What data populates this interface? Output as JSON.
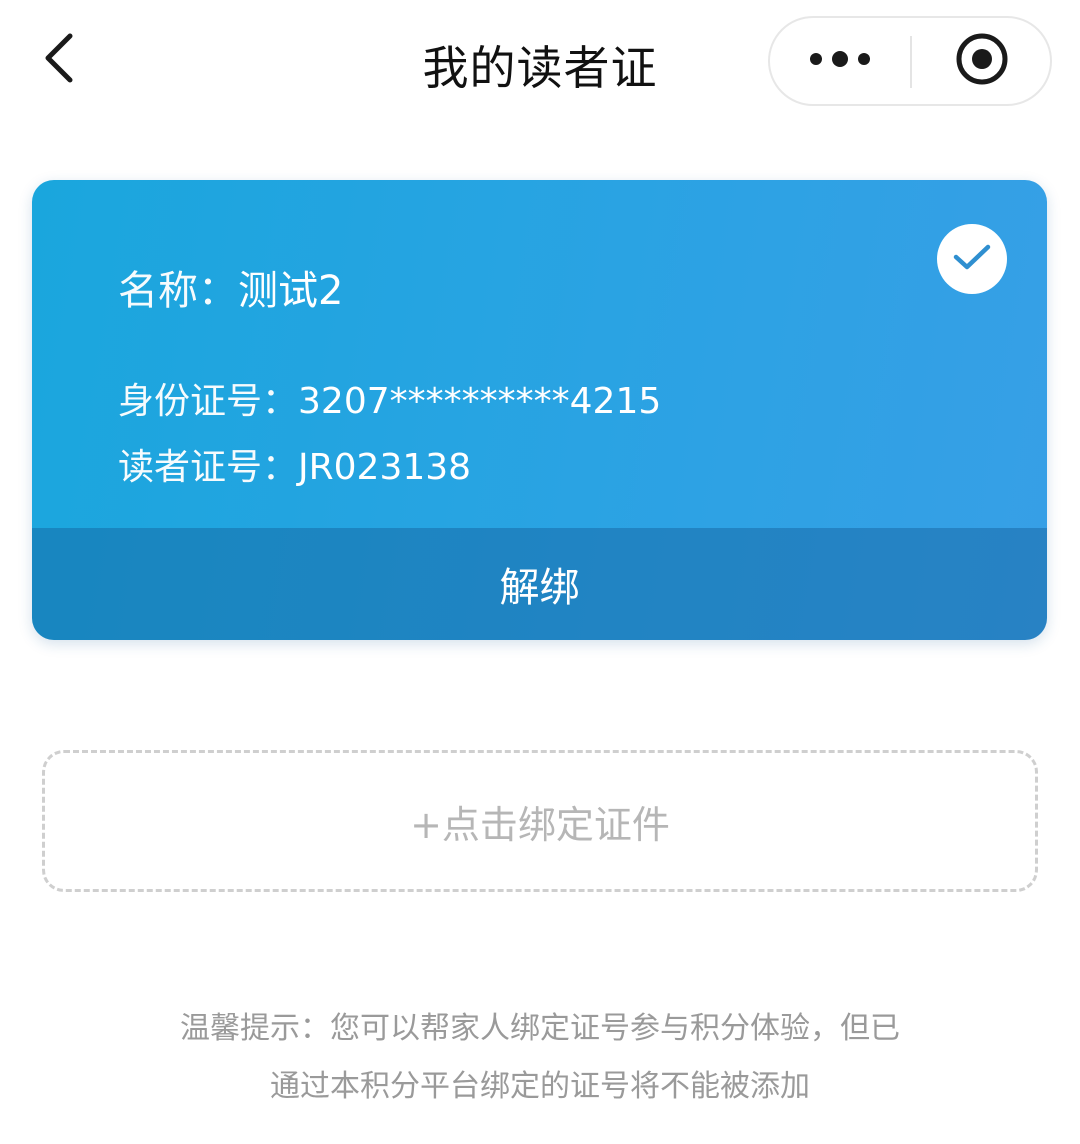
{
  "header": {
    "title": "我的读者证",
    "back_icon": "chevron-left-icon",
    "more_icon": "more-dots-icon",
    "close_icon": "target-close-icon"
  },
  "card": {
    "selected": true,
    "name_label": "名称：",
    "name_value": "测试2",
    "id_label": "身份证号：",
    "id_value": "3207**********4215",
    "reader_label": "读者证号：",
    "reader_value": "JR023138",
    "unbind_label": "解绑",
    "colors": {
      "card_start": "#1aa6dd",
      "card_end": "#379fe6",
      "unbind_bar": "#2f78a8"
    }
  },
  "bind": {
    "label": "+点击绑定证件"
  },
  "tip": {
    "line1": "温馨提示：您可以帮家人绑定证号参与积分体验，但已",
    "line2": "通过本积分平台绑定的证号将不能被添加"
  }
}
